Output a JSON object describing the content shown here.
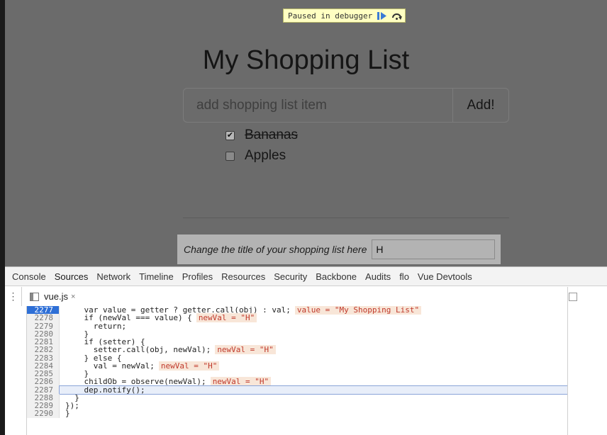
{
  "debugger": {
    "paused_label": "Paused in debugger",
    "resume_icon": "resume-icon",
    "step_over_icon": "step-over-icon"
  },
  "app": {
    "title": "My Shopping List",
    "input_placeholder": "add shopping list item",
    "add_label": "Add!",
    "items": [
      {
        "label": "Bananas",
        "checked": true
      },
      {
        "label": "Apples",
        "checked": false
      }
    ],
    "title_change_label": "Change the title of your shopping list here",
    "title_change_value": "H"
  },
  "devtools": {
    "tabs": [
      "Console",
      "Sources",
      "Network",
      "Timeline",
      "Profiles",
      "Resources",
      "Security",
      "Backbone",
      "Audits",
      "flo",
      "Vue Devtools"
    ],
    "active_tab": "Sources",
    "file_tab": "vue.js",
    "code": [
      {
        "n": "2277",
        "text": "    var value = getter ? getter.call(obj) : val;",
        "inline": "value = \"My Shopping List\""
      },
      {
        "n": "2278",
        "text": "    if (newVal === value) {",
        "inline": "newVal = \"H\""
      },
      {
        "n": "2279",
        "text": "      return;",
        "inline": ""
      },
      {
        "n": "2280",
        "text": "    }",
        "inline": ""
      },
      {
        "n": "2281",
        "text": "    if (setter) {",
        "inline": ""
      },
      {
        "n": "2282",
        "text": "      setter.call(obj, newVal);",
        "inline": "newVal = \"H\""
      },
      {
        "n": "2283",
        "text": "    } else {",
        "inline": ""
      },
      {
        "n": "2284",
        "text": "      val = newVal;",
        "inline": "newVal = \"H\""
      },
      {
        "n": "2285",
        "text": "    }",
        "inline": ""
      },
      {
        "n": "2286",
        "text": "    childOb = observe(newVal);",
        "inline": "newVal = \"H\""
      },
      {
        "n": "2287",
        "text": "    dep.notify();",
        "inline": ""
      },
      {
        "n": "2288",
        "text": "  }",
        "inline": ""
      },
      {
        "n": "2289",
        "text": "});",
        "inline": ""
      },
      {
        "n": "2290",
        "text": "}",
        "inline": ""
      }
    ],
    "highlight_line": "2287",
    "breakpoint_line": "2277"
  }
}
